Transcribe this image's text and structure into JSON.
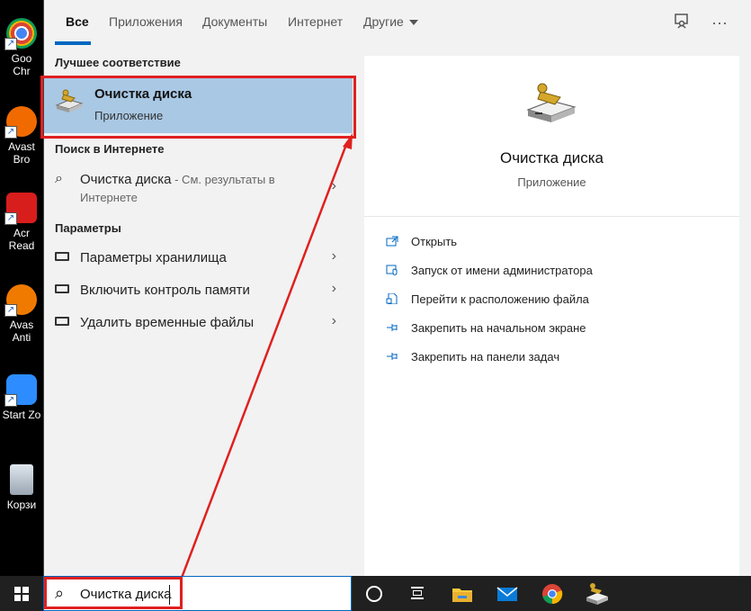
{
  "desktop": {
    "items": [
      {
        "label": "Goo\nChr",
        "color": "#1e8e3e"
      },
      {
        "label": "Avast\nBro",
        "color": "#f06a00"
      },
      {
        "label": "Acr\nRead",
        "color": "#d81d1d"
      },
      {
        "label": "Avas\nAnti",
        "color": "#f07a00"
      },
      {
        "label": "Start Zo",
        "color": "#2d8cff"
      },
      {
        "label": "Корзи",
        "color": "#9aa6b2"
      }
    ]
  },
  "tabs": [
    {
      "label": "Все"
    },
    {
      "label": "Приложения"
    },
    {
      "label": "Документы"
    },
    {
      "label": "Интернет"
    },
    {
      "label": "Другие"
    }
  ],
  "toolbar": {
    "feedback_icon": "feedback-icon",
    "more_icon": "more-icon",
    "more_glyph": "···"
  },
  "left": {
    "best_match_header": "Лучшее соответствие",
    "best_match": {
      "title": "Очистка диска",
      "subtitle": "Приложение"
    },
    "web_header": "Поиск в Интернете",
    "web_result": {
      "title": "Очистка диска",
      "suffix": " - См. результаты в Интернете"
    },
    "settings_header": "Параметры",
    "settings": [
      {
        "label": "Параметры хранилища"
      },
      {
        "label": "Включить контроль памяти"
      },
      {
        "label": "Удалить временные файлы"
      }
    ]
  },
  "right": {
    "app_title": "Очистка диска",
    "app_subtitle": "Приложение",
    "actions": [
      {
        "label": "Открыть",
        "icon": "open-icon"
      },
      {
        "label": "Запуск от имени администратора",
        "icon": "shield-icon"
      },
      {
        "label": "Перейти к расположению файла",
        "icon": "file-location-icon"
      },
      {
        "label": "Закрепить на начальном экране",
        "icon": "pin-icon"
      },
      {
        "label": "Закрепить на панели задач",
        "icon": "pin-icon"
      }
    ]
  },
  "taskbar": {
    "search_value": "Очистка диска"
  },
  "colors": {
    "accent": "#0067c0",
    "highlight": "#a9c8e4",
    "annotation": "#e02020"
  }
}
